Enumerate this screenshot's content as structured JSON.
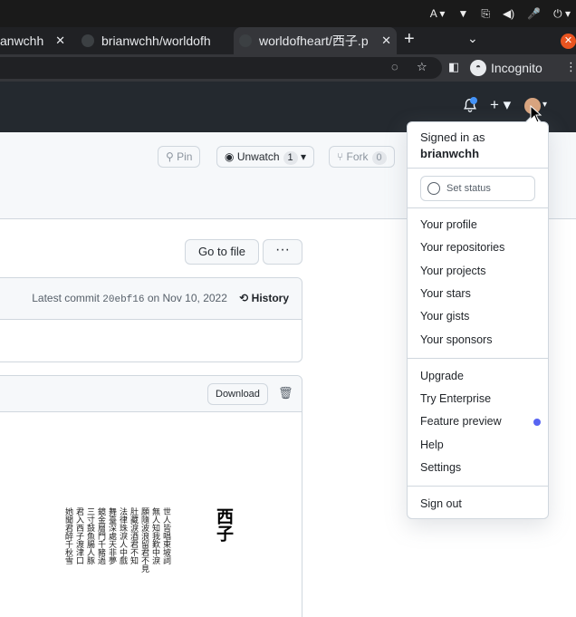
{
  "os": {
    "tray": [
      "A ▾",
      "▼",
      "⎘",
      "◀)",
      "🎤",
      "⏻ ▾"
    ]
  },
  "tabs": [
    {
      "label": "anwchh"
    },
    {
      "label": "brianwchh/worldofh"
    },
    {
      "label": "worldofheart/西子.p"
    }
  ],
  "toolbar": {
    "incognito": "Incognito"
  },
  "repo": {
    "pin": "Pin",
    "unwatch": "Unwatch",
    "unwatch_count": "1",
    "fork": "Fork",
    "fork_count": "0"
  },
  "file": {
    "go_to_file": "Go to file",
    "more": "···",
    "latest_commit_label": "Latest commit",
    "commit_sha": "20ebf16",
    "commit_date": "on Nov 10, 2022",
    "history": "History",
    "download": "Download"
  },
  "preview": {
    "title": "西子",
    "columns": [
      "世人皆唱東坡詞",
      "無人知我歎中淚",
      "願隨波浪留君不見",
      "肚藏淚酒君不知",
      "法律珠淚人中戲",
      "舞臺深處天非夢",
      "鏡金層門千豬過",
      "三寸鼓魚腸人豚",
      "君入西子渡津口",
      "她聞君醉千秋雪"
    ]
  },
  "menu": {
    "signed_in_as": "Signed in as",
    "username": "brianwchh",
    "set_status": "Set status",
    "items_1": [
      "Your profile",
      "Your repositories",
      "Your projects",
      "Your stars",
      "Your gists",
      "Your sponsors"
    ],
    "items_2": [
      "Upgrade",
      "Try Enterprise",
      "Feature preview",
      "Help",
      "Settings"
    ],
    "sign_out": "Sign out",
    "accent_dot": "#5865f2"
  }
}
